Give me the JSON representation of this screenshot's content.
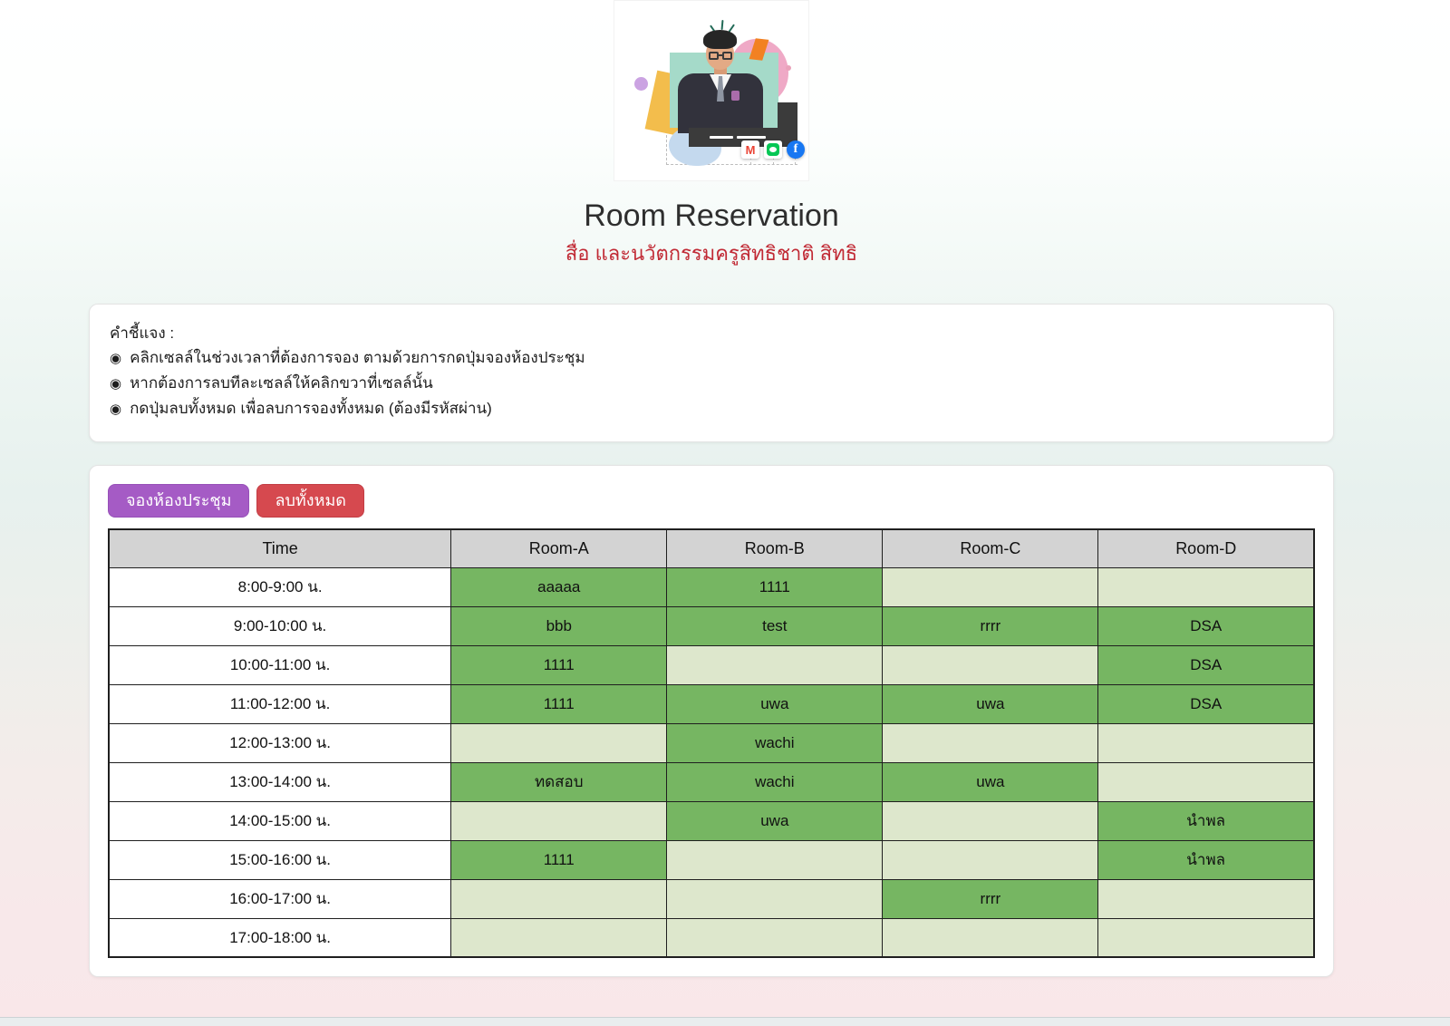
{
  "page": {
    "title": "Room Reservation",
    "subtitle": "สื่อ และนวัตกรรมครูสิทธิชาติ สิทธิ"
  },
  "header_illustration": {
    "icons": [
      "gmail-icon",
      "line-icon",
      "facebook-icon"
    ],
    "gmail_letter": "M",
    "facebook_letter": "f"
  },
  "instructions": {
    "heading": "คำชี้แจง :",
    "bullet": "◉",
    "items": [
      "คลิกเซลล์ในช่วงเวลาที่ต้องการจอง ตามด้วยการกดปุ่มจองห้องประชุม",
      "หากต้องการลบทีละเซลล์ให้คลิกขวาที่เซลล์นั้น",
      "กดปุ่มลบทั้งหมด เพื่อลบการจองทั้งหมด (ต้องมีรหัสผ่าน)"
    ]
  },
  "toolbar": {
    "reserve_label": "จองห้องประชุม",
    "delete_all_label": "ลบทั้งหมด"
  },
  "table": {
    "columns": [
      "Time",
      "Room-A",
      "Room-B",
      "Room-C",
      "Room-D"
    ],
    "rows": [
      {
        "time": "8:00-9:00 น.",
        "cells": [
          {
            "text": "aaaaa",
            "booked": true
          },
          {
            "text": "1111",
            "booked": true
          },
          {
            "text": "",
            "booked": false
          },
          {
            "text": "",
            "booked": false
          }
        ]
      },
      {
        "time": "9:00-10:00 น.",
        "cells": [
          {
            "text": "bbb",
            "booked": true
          },
          {
            "text": "test",
            "booked": true
          },
          {
            "text": "rrrr",
            "booked": true
          },
          {
            "text": "DSA",
            "booked": true
          }
        ]
      },
      {
        "time": "10:00-11:00 น.",
        "cells": [
          {
            "text": "1111",
            "booked": true
          },
          {
            "text": "",
            "booked": false
          },
          {
            "text": "",
            "booked": false
          },
          {
            "text": "DSA",
            "booked": true
          }
        ]
      },
      {
        "time": "11:00-12:00 น.",
        "cells": [
          {
            "text": "1111",
            "booked": true
          },
          {
            "text": "uwa",
            "booked": true
          },
          {
            "text": "uwa",
            "booked": true
          },
          {
            "text": "DSA",
            "booked": true
          }
        ]
      },
      {
        "time": "12:00-13:00 น.",
        "cells": [
          {
            "text": "",
            "booked": false
          },
          {
            "text": "wachi",
            "booked": true
          },
          {
            "text": "",
            "booked": false
          },
          {
            "text": "",
            "booked": false
          }
        ]
      },
      {
        "time": "13:00-14:00 น.",
        "cells": [
          {
            "text": "ทดสอบ",
            "booked": true
          },
          {
            "text": "wachi",
            "booked": true
          },
          {
            "text": "uwa",
            "booked": true
          },
          {
            "text": "",
            "booked": false
          }
        ]
      },
      {
        "time": "14:00-15:00 น.",
        "cells": [
          {
            "text": "",
            "booked": false
          },
          {
            "text": "uwa",
            "booked": true
          },
          {
            "text": "",
            "booked": false
          },
          {
            "text": "นำพล",
            "booked": true
          }
        ]
      },
      {
        "time": "15:00-16:00 น.",
        "cells": [
          {
            "text": "1111",
            "booked": true
          },
          {
            "text": "",
            "booked": false
          },
          {
            "text": "",
            "booked": false
          },
          {
            "text": "นำพล",
            "booked": true
          }
        ]
      },
      {
        "time": "16:00-17:00 น.",
        "cells": [
          {
            "text": "",
            "booked": false
          },
          {
            "text": "",
            "booked": false
          },
          {
            "text": "rrrr",
            "booked": true
          },
          {
            "text": "",
            "booked": false
          }
        ]
      },
      {
        "time": "17:00-18:00 น.",
        "cells": [
          {
            "text": "",
            "booked": false
          },
          {
            "text": "",
            "booked": false
          },
          {
            "text": "",
            "booked": false
          },
          {
            "text": "",
            "booked": false
          }
        ]
      }
    ]
  },
  "colors": {
    "booked_green": "#76b662",
    "free_green": "#dde7cc",
    "header_gray": "#d3d3d3",
    "reserve_purple": "#a55bc5",
    "delete_red": "#d6494f",
    "subtitle_red": "#c12a35"
  }
}
